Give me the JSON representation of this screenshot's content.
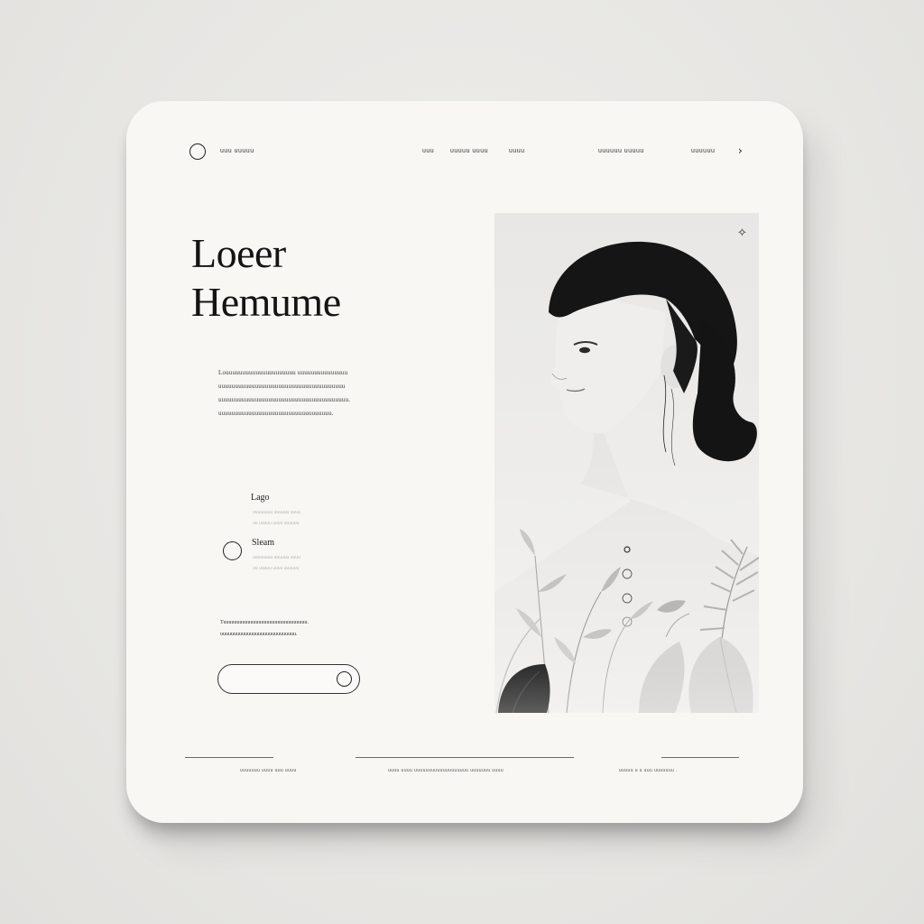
{
  "nav": {
    "brand": "uuu uuuuu",
    "links": [
      "uuu",
      "uuuuu uuuu",
      "uuuu"
    ],
    "account": "uuuuuu uuuuu",
    "action": "uuuuuu",
    "chevron": "›"
  },
  "hero": {
    "title_line1": "Loeer",
    "title_line2": "Hemume",
    "description": [
      "Louuuuuuuuuuuuuuuuuuuuu uuuuuuuuuuuuuuu",
      "uuuuuuuuuuuuuuuuuuuuuuuuuuuuuuuuuuuuuu",
      "uuuuuuuuuuuuuuuuuuuuuuuuuuuuuuuuuuuuuuu.",
      "uuuuuuuuuuuuuuuuuuuuuuuuuuuuuuuuuu."
    ]
  },
  "features": [
    {
      "title": "Lago",
      "subtitle": [
        "uuuuuuuu uuuuuu uuuu",
        "uu uuuuu uuuu uuuuuu"
      ]
    },
    {
      "title": "Sleam",
      "subtitle": [
        "uuuuuuuu uuuuuu uuuu",
        "uu uuuuu uuuu uuuuuu"
      ]
    }
  ],
  "note": [
    "Tuuuuuuuuuuuuuuuuuuuuuuuuuuuuuuu.",
    "uuuuuuuuuuuuuuuuuuuuuuuuuuuu."
  ],
  "panel": {
    "sparkle": "✧"
  },
  "footer": {
    "left": "uuuuuuu uuuu uuu uuuu",
    "center": "uuuu uuuu uuuuuuuuuuuuuuuuuuu uuuuuuu uuuu",
    "right": "uuuuu u u uuu uuuuuuu ."
  },
  "colors": {
    "card": "#f8f7f4",
    "background": "#e9e8e5",
    "ink": "#1c1c1c"
  }
}
